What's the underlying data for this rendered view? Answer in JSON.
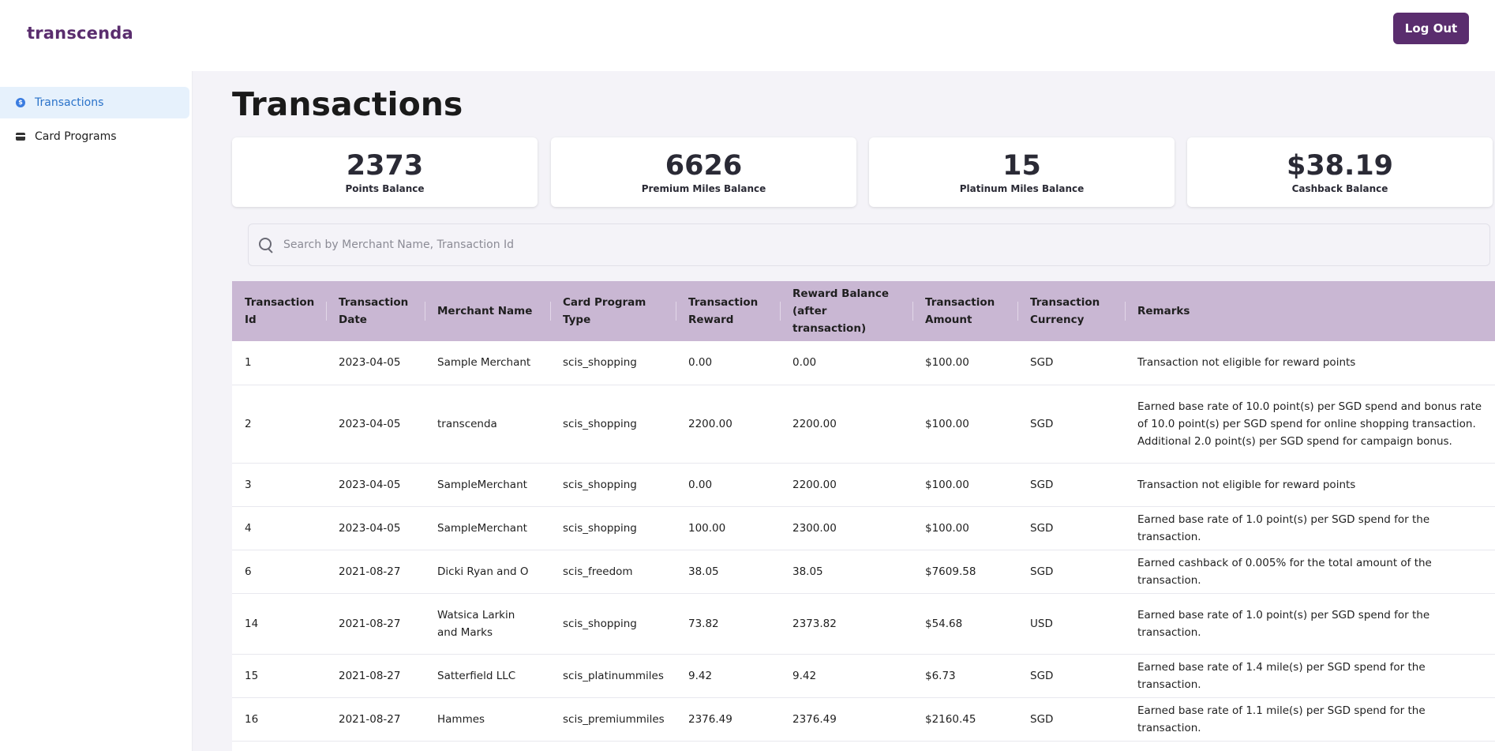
{
  "brand": {
    "name": "transcenda"
  },
  "header": {
    "logout_label": "Log Out"
  },
  "sidebar": {
    "items": [
      {
        "label": "Transactions",
        "icon": "dollar-circle-icon",
        "active": true
      },
      {
        "label": "Card Programs",
        "icon": "credit-card-icon",
        "active": false
      }
    ]
  },
  "main": {
    "title": "Transactions",
    "stats": [
      {
        "value": "2373",
        "label": "Points Balance"
      },
      {
        "value": "6626",
        "label": "Premium Miles Balance"
      },
      {
        "value": "15",
        "label": "Platinum Miles Balance"
      },
      {
        "value": "$38.19",
        "label": "Cashback Balance"
      }
    ],
    "search": {
      "placeholder": "Search by Merchant Name, Transaction Id",
      "value": ""
    },
    "table": {
      "headers": [
        "Transaction Id",
        "Transaction Date",
        "Merchant Name",
        "Card Program Type",
        "Transaction Reward",
        "Reward Balance (after transaction)",
        "Transaction Amount",
        "Transaction Currency",
        "Remarks"
      ],
      "rows": [
        [
          "1",
          "2023-04-05",
          "Sample Merchant",
          "scis_shopping",
          "0.00",
          "0.00",
          "$100.00",
          "SGD",
          "Transaction not eligible for reward points"
        ],
        [
          "2",
          "2023-04-05",
          "transcenda",
          "scis_shopping",
          "2200.00",
          "2200.00",
          "$100.00",
          "SGD",
          "Earned base rate of 10.0 point(s) per SGD spend and bonus rate of 10.0 point(s) per SGD spend for online shopping transaction. Additional 2.0 point(s) per SGD spend for campaign bonus."
        ],
        [
          "3",
          "2023-04-05",
          "SampleMerchant",
          "scis_shopping",
          "0.00",
          "2200.00",
          "$100.00",
          "SGD",
          "Transaction not eligible for reward points"
        ],
        [
          "4",
          "2023-04-05",
          "SampleMerchant",
          "scis_shopping",
          "100.00",
          "2300.00",
          "$100.00",
          "SGD",
          "Earned base rate of 1.0 point(s) per SGD spend for the transaction."
        ],
        [
          "6",
          "2021-08-27",
          "Dicki Ryan and O",
          "scis_freedom",
          "38.05",
          "38.05",
          "$7609.58",
          "SGD",
          "Earned cashback of 0.005% for the total amount of the transaction."
        ],
        [
          "14",
          "2021-08-27",
          "Watsica Larkin and Marks",
          "scis_shopping",
          "73.82",
          "2373.82",
          "$54.68",
          "USD",
          "Earned base rate of 1.0 point(s) per SGD spend for the transaction."
        ],
        [
          "15",
          "2021-08-27",
          "Satterfield LLC",
          "scis_platinummiles",
          "9.42",
          "9.42",
          "$6.73",
          "SGD",
          "Earned base rate of 1.4 mile(s) per SGD spend for the transaction."
        ],
        [
          "16",
          "2021-08-27",
          "Hammes",
          "scis_premiummiles",
          "2376.49",
          "2376.49",
          "$2160.45",
          "SGD",
          "Earned base rate of 1.1 mile(s) per SGD spend for the transaction."
        ]
      ]
    }
  },
  "colors": {
    "brand": "#5a2d6e",
    "table_header": "#c9b7d3",
    "active_nav_bg": "#e6f1fc",
    "active_nav_text": "#2a72c9",
    "page_bg": "#f4f3f8"
  }
}
